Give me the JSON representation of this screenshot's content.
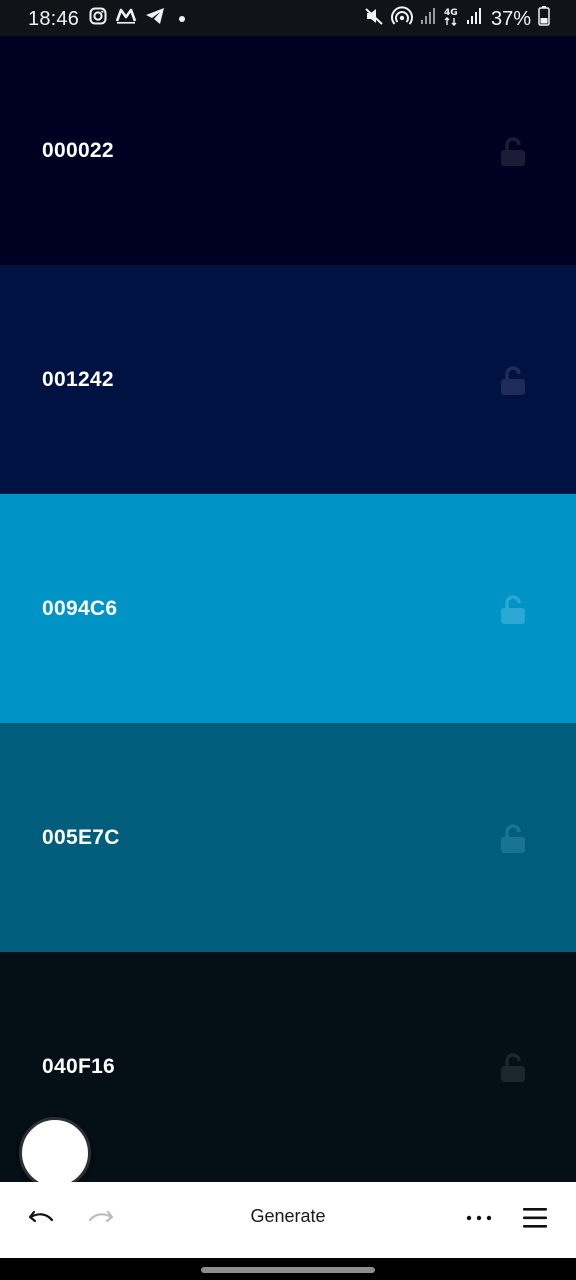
{
  "status_bar": {
    "time": "18:46",
    "battery": "37%",
    "icons_left": [
      "instagram-icon",
      "app-logo-icon",
      "telegram-icon",
      "notification-dot"
    ],
    "icons_right": [
      "mute-icon",
      "hotspot-icon",
      "signal-icon",
      "4g-icon",
      "signal-icon",
      "battery-icon"
    ]
  },
  "palette": {
    "colors": [
      {
        "hex": "000022",
        "bg": "#000022",
        "text": "#ffffff",
        "lock": "#1c1c36",
        "locked": false
      },
      {
        "hex": "001242",
        "bg": "#001242",
        "text": "#ffffff",
        "lock": "#1e2c57",
        "locked": false
      },
      {
        "hex": "0094C6",
        "bg": "#0094C6",
        "text": "#ffffff",
        "lock": "#2aa8d4",
        "locked": false
      },
      {
        "hex": "005E7C",
        "bg": "#005E7C",
        "text": "#ffffff",
        "lock": "#1a7390",
        "locked": false
      },
      {
        "hex": "040F16",
        "bg": "#040F16",
        "text": "#ffffff",
        "lock": "#1c262d",
        "locked": false
      }
    ]
  },
  "toolbar": {
    "generate_label": "Generate",
    "undo_icon": "undo-icon",
    "redo_icon": "redo-icon",
    "more_icon": "more-horizontal-icon",
    "menu_icon": "hamburger-menu-icon"
  }
}
